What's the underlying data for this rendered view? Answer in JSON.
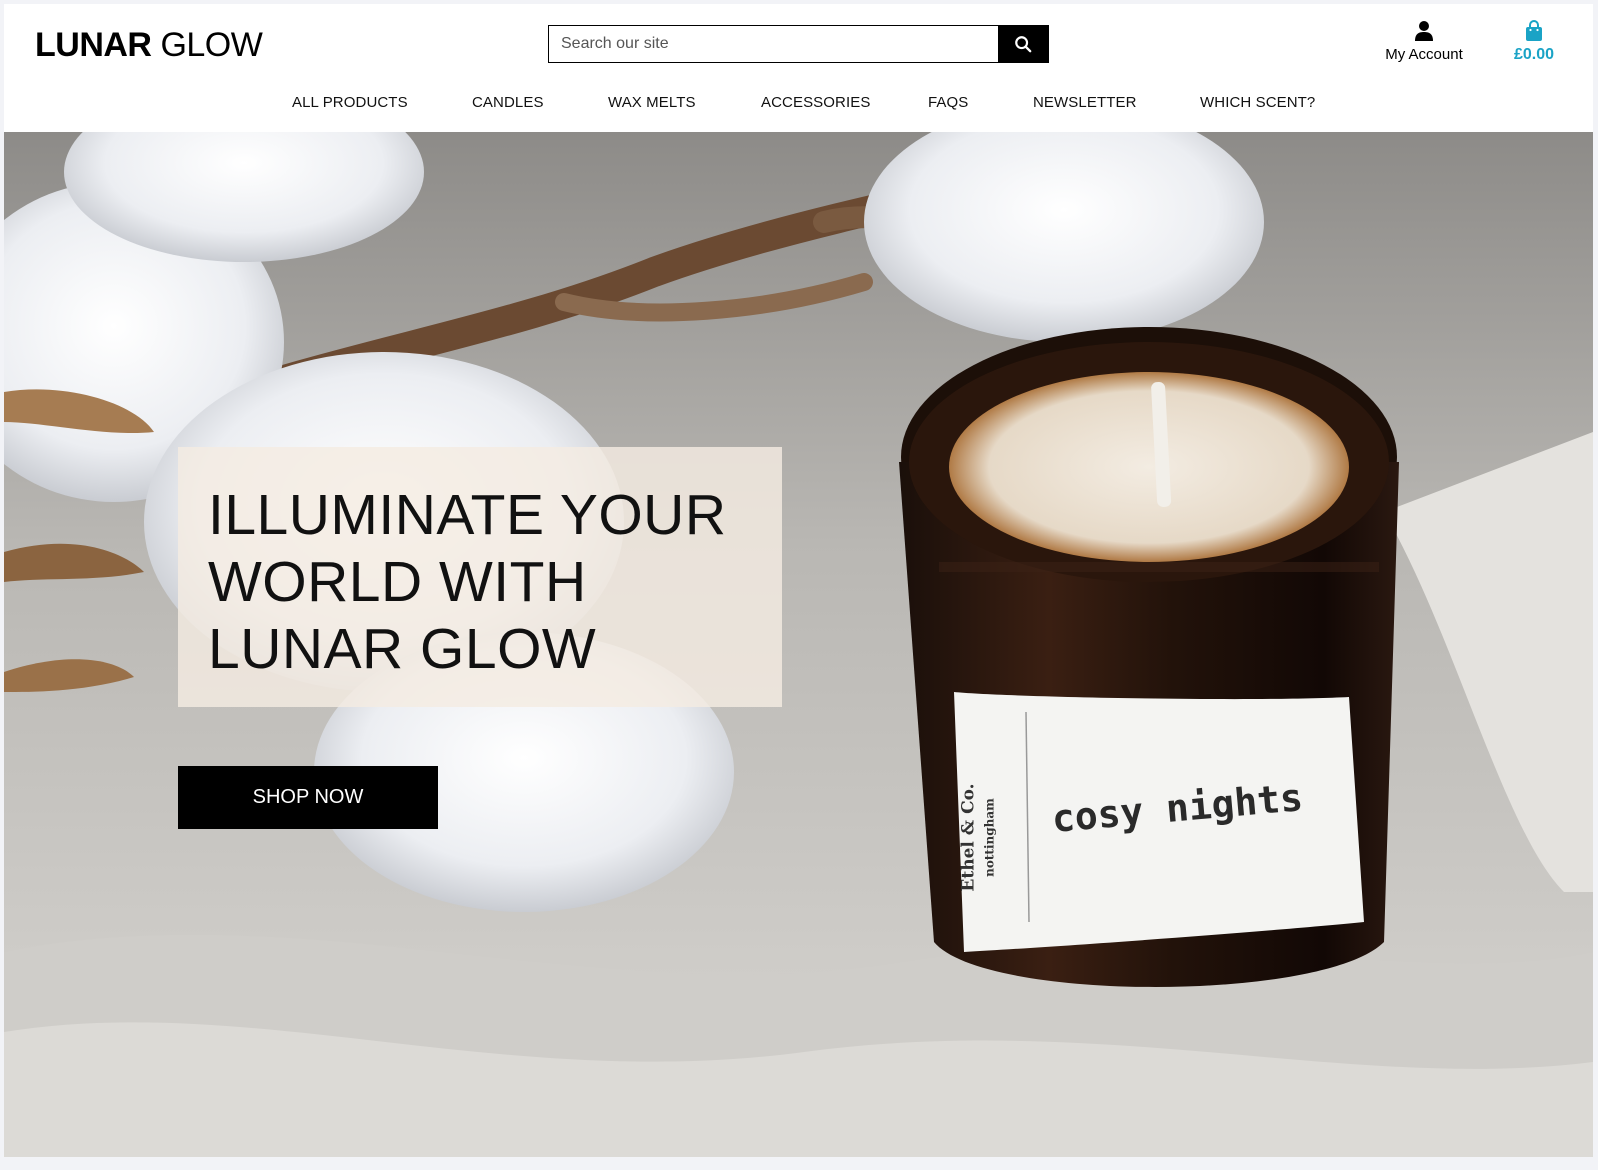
{
  "header": {
    "logo_bold": "LUNAR",
    "logo_light": "GLOW",
    "search_placeholder": "Search our site",
    "search_icon": "search-icon",
    "account_label": "My Account",
    "account_icon": "user-icon",
    "bag_total": "£0.00",
    "bag_icon": "shopping-bag-icon",
    "accent_color": "#1aa3c6"
  },
  "nav": {
    "items": [
      "ALL PRODUCTS",
      "CANDLES",
      "WAX MELTS",
      "ACCESSORIES",
      "FAQS",
      "NEWSLETTER",
      "WHICH SCENT?"
    ]
  },
  "hero": {
    "headline_line1": "ILLUMINATE YOUR",
    "headline_line2": "WORLD WITH",
    "headline_line3": "LUNAR GLOW",
    "cta_label": "SHOP NOW",
    "candle_label": "cosy nights",
    "candle_brand_line1": "Ethel & Co.",
    "candle_brand_line2": "nottingham"
  }
}
